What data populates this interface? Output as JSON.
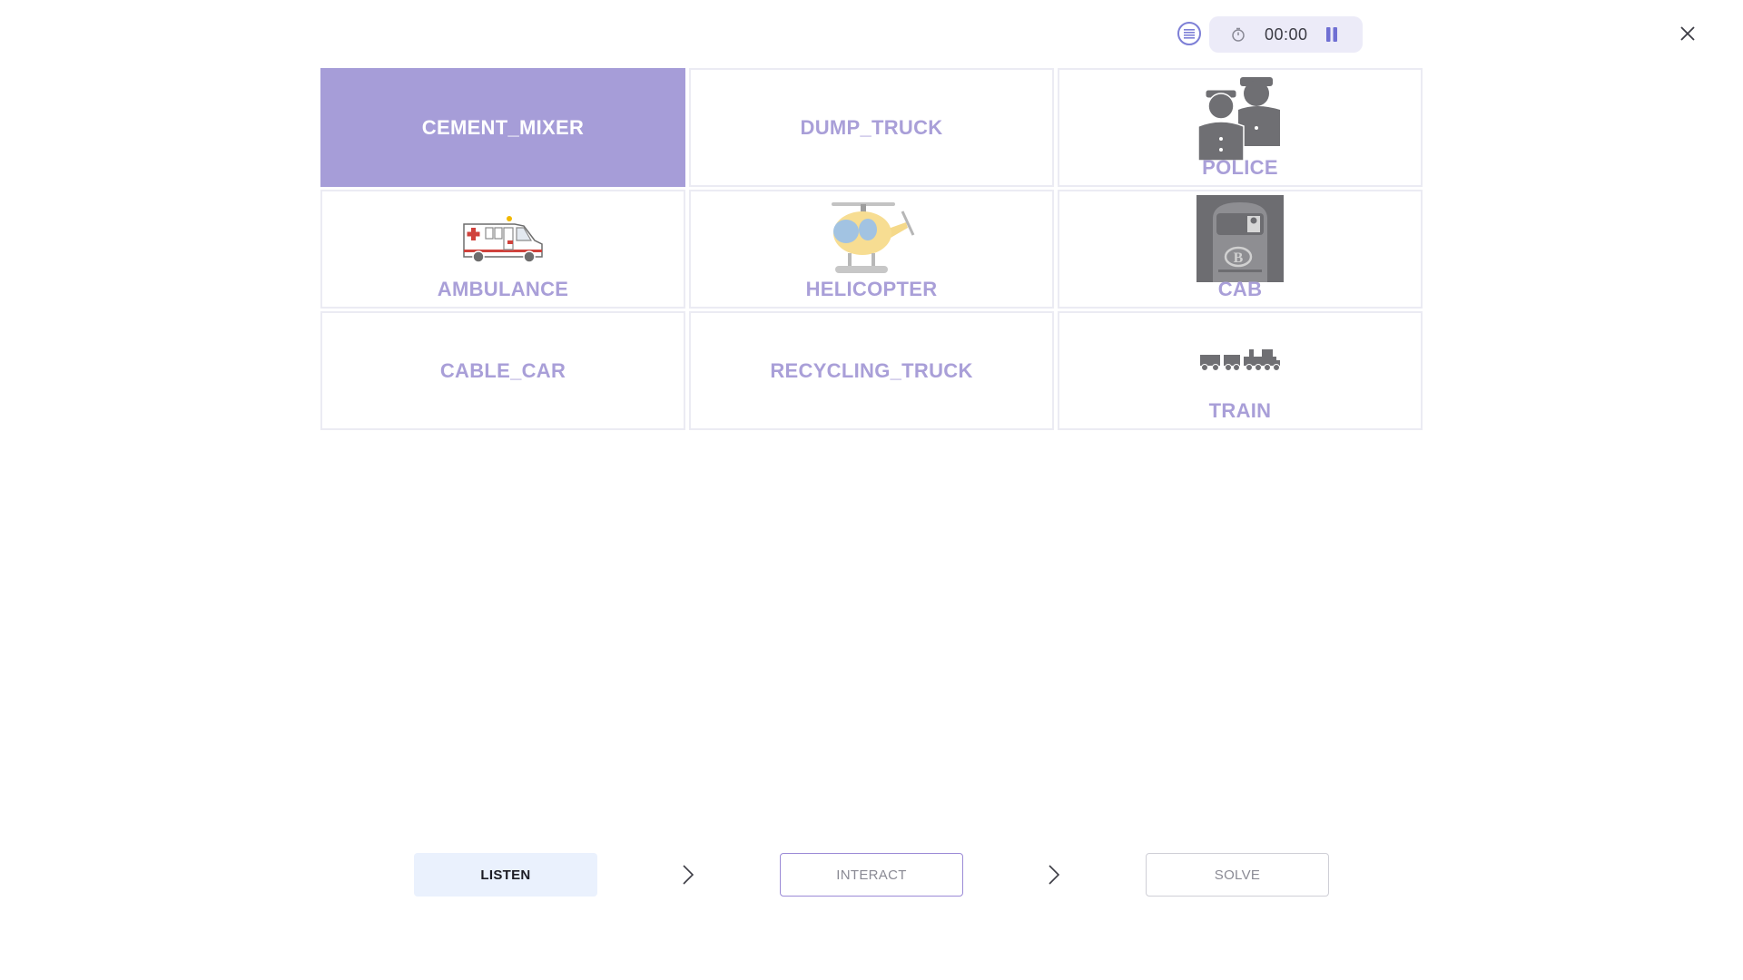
{
  "toolbar": {
    "list_icon": "list-icon",
    "timer": {
      "clock_icon": "clock-icon",
      "time": "00:00",
      "pause_icon": "pause-icon"
    },
    "close_icon": "close-icon",
    "accent": "#7d7fd6"
  },
  "grid": {
    "selected_color": "#a69dd8",
    "label_color": "#a99fd8",
    "cells": [
      {
        "label": "CEMENT_MIXER",
        "image": null,
        "selected": true
      },
      {
        "label": "DUMP_TRUCK",
        "image": null,
        "selected": false
      },
      {
        "label": "POLICE",
        "image": "police-officers-icon",
        "selected": false
      },
      {
        "label": "AMBULANCE",
        "image": "ambulance-icon",
        "selected": false
      },
      {
        "label": "HELICOPTER",
        "image": "helicopter-icon",
        "selected": false
      },
      {
        "label": "CAB",
        "image": "train-cab-icon",
        "selected": false
      },
      {
        "label": "CABLE_CAR",
        "image": null,
        "selected": false
      },
      {
        "label": "RECYCLING_TRUCK",
        "image": null,
        "selected": false
      },
      {
        "label": "TRAIN",
        "image": "train-icon",
        "selected": false
      }
    ]
  },
  "steps": {
    "listen": "LISTEN",
    "interact": "INTERACT",
    "solve": "SOLVE",
    "chevron_icon": "chevron-right-icon"
  }
}
